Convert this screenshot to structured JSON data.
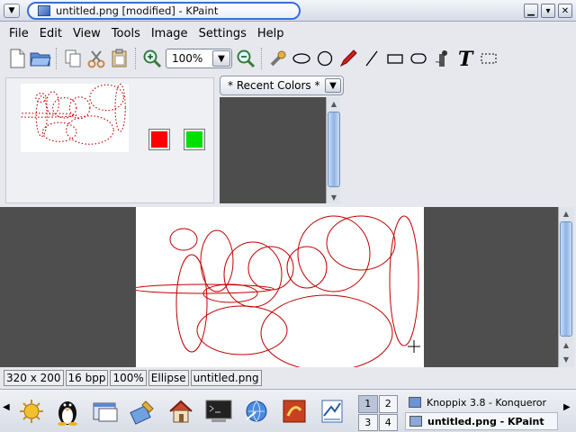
{
  "window": {
    "title": "untitled.png [modified] - KPaint",
    "buttons": {
      "minimize": "▁",
      "maximize": "▾",
      "close": "✕"
    }
  },
  "menu": [
    {
      "label": "File"
    },
    {
      "label": "Edit"
    },
    {
      "label": "View"
    },
    {
      "label": "Tools"
    },
    {
      "label": "Image"
    },
    {
      "label": "Settings"
    },
    {
      "label": "Help"
    }
  ],
  "toolbar": {
    "zoom_value": "100%"
  },
  "colors": {
    "left_color": "#ff0000",
    "right_color": "#00e000",
    "recent_label": "* Recent Colors *",
    "ellipse_stroke": "#c00000",
    "canvas_bg": "#4e4e4e"
  },
  "status": {
    "size": "320 x 200",
    "depth": "16 bpp",
    "zoom": "100%",
    "tool": "Ellipse",
    "filename": "untitled.png"
  },
  "taskbar": {
    "pager": [
      "1",
      "2",
      "3",
      "4"
    ],
    "tasks": [
      {
        "label": "Knoppix 3.8 - Konqueror",
        "active": false
      },
      {
        "label": "untitled.png - KPaint",
        "active": true
      }
    ]
  }
}
